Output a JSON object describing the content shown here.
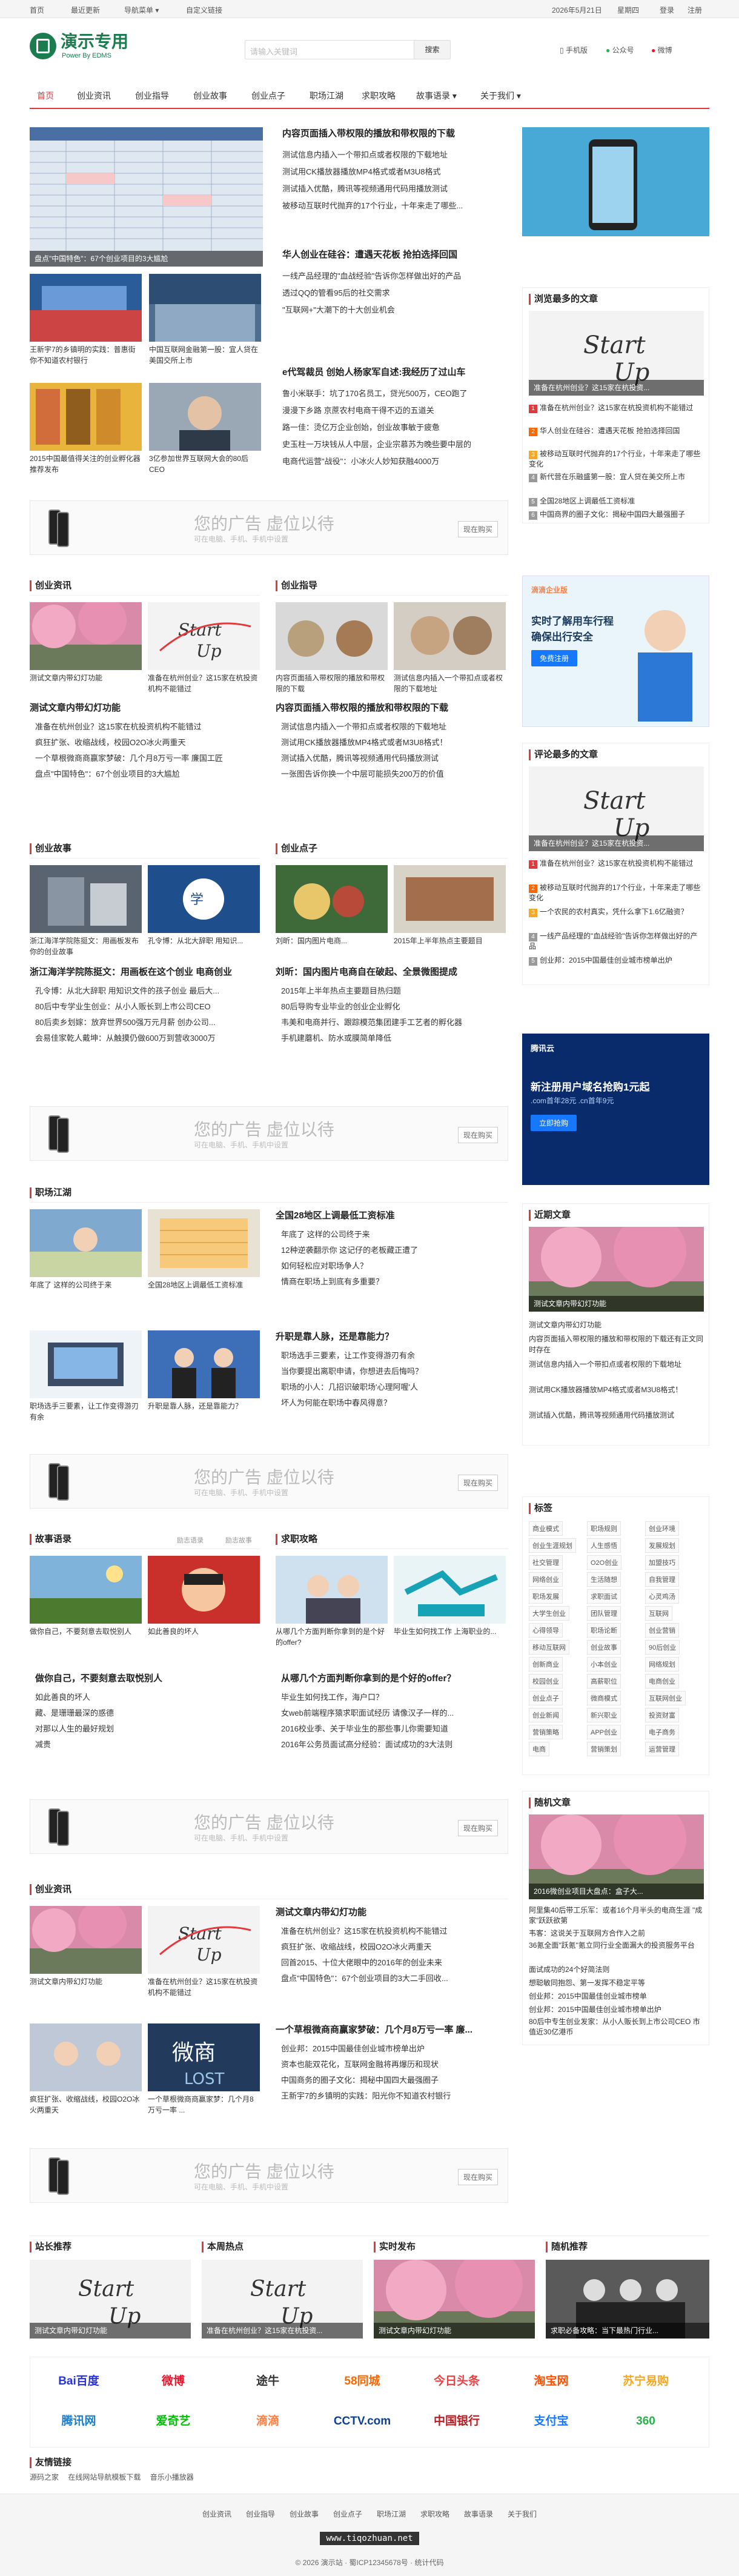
{
  "topbar": {
    "links": [
      "首页",
      "最近更新",
      "导航菜单 ▾",
      "自定义链接"
    ],
    "date": "2026年5月21日",
    "tools": [
      "星期四",
      "登录",
      "注册"
    ]
  },
  "header": {
    "logo_title": "演示专用",
    "logo_sub": "Power By EDMS",
    "search_placeholder": "请输入关键词",
    "search_button": "搜索",
    "icons": [
      "手机版",
      "公众号",
      "微博"
    ]
  },
  "nav": [
    "首页",
    "创业资讯",
    "创业指导",
    "创业故事",
    "创业点子",
    "职场江湖",
    "求职攻略",
    "故事语录 ▾",
    "关于我们 ▾"
  ],
  "slider": {
    "caption": "盘点\"中国特色\"：67个创业项目的3大尴尬"
  },
  "hero_thumbs": [
    {
      "cap": "王新宇7的乡镇明的实践：普惠街你不知道农村银行"
    },
    {
      "cap": "中国互联网金融第一股：宜人贷在美国交所上市"
    },
    {
      "cap": "2015中国最值得关注的创业孵化器推荐发布"
    },
    {
      "cap": "3亿参加世界互联网大会的80后CEO"
    }
  ],
  "hero_news": [
    {
      "title": "内容页面插入带权限的播放和带权限的下载",
      "items": [
        "测试信息内插入一个带扣点或者权限的下载地址",
        "测试用CK播放器播放MP4格式或者M3U8格式",
        "测试插入优酷，腾讯等视频通用代码用播放测试",
        "被移动互联时代抛弃的17个行业，十年来走了哪些..."
      ]
    },
    {
      "title": "华人创业在硅谷：遭遇天花板 抢拍选择回国",
      "items": [
        "一线产品经理的\"血战经验\"告诉你怎样做出好的产品",
        "透过QQ的管看95后的社交需求",
        "\"互联网+\"大潮下的十大创业机会"
      ]
    },
    {
      "title": "e代驾裁员 创始人杨家军自述:我经历了过山车",
      "items": [
        "鲁小米联手：坑了170名员工，贷光500万，CEO跑了",
        "漫漫下乡路 京蔗农村电商干得不迈的五道关",
        "路一佳：烫亿万企业创始，创业故事敏于疲惫",
        "史玉柱一万块钱从人中层，企业宗慕苏为晚些要中层的",
        "电商代运营\"战役\"：小冰火人妙知获融4000万"
      ]
    }
  ],
  "ads": {
    "title": "您的广告 虚位以待",
    "sub": "可在电脑、手机、手机中设置",
    "btn": "现在购买"
  },
  "sections": [
    {
      "left": "创业资讯",
      "right": "创业指导",
      "lthumbs": [
        "测试文章内带幻灯功能",
        "准备在杭州创业？这15家在杭投资机构不能错过"
      ],
      "rthumbs": [
        "内容页面插入带权限的播放和带权限的下载",
        "测试信息内插入一个带扣点或者权限的下载地址"
      ],
      "lhead": "测试文章内带幻灯功能",
      "litems": [
        "准备在杭州创业？这15家在杭投资机构不能错过",
        "疯狂扩张、收缩战线，校园O2O冰火两重天",
        "一个草根微商商赢家梦破：几个月8万亏一率 廉国工匠",
        "盘点\"中国特色\"：67个创业项目的3大尴尬"
      ],
      "rhead": "内容页面插入带权限的播放和带权限的下载",
      "ritems": [
        "测试信息内插入一个带扣点或者权限的下载地址",
        "测试用CK播放器播放MP4格式或者M3U8格式！",
        "测试插入优酷，腾讯等视频通用代码播放测试",
        "一张图告诉你换一个中层可能损失200万的价值"
      ]
    },
    {
      "left": "创业故事",
      "right": "创业点子",
      "lthumbs": [
        "浙江海洋学院陈挺文：用画板发布你的创业故事",
        "孔令博：从北大辞职 用知识..."
      ],
      "rthumbs": [
        "刘昕：国内图片电商...",
        "2015年上半年热点主要题目"
      ],
      "lhead": "浙江海洋学院陈挺文：用画板在这个创业 电商创业",
      "litems": [
        "孔令博：从北大辞职 用知识文件的孩子创业 最后大...",
        "80后中专学业生创业：从小人贩长到上市公司CEO",
        "80后卖乡划嫁：放弃世界500强万元月薪 创办公司...",
        "会易佳家乾人戴坤：从触摸仍做600万到营收3000万"
      ],
      "rhead": "刘昕：国内图片电商自在破起、全景微图提成",
      "ritems": [
        "2015年上半年热点主要题目热归题",
        "80后导购专业毕业的创业企业孵化",
        "韦美和电商并行、跟踪模范集团建手工艺者的孵化器",
        "手机建蘑机、防水或膜简单降低"
      ]
    }
  ],
  "career": {
    "left": "职场江湖",
    "thumbs": [
      "年底了 这样的公司终于来",
      "全国28地区上调最低工资标准"
    ],
    "thumbs2": [
      "职场选手三要素，让工作变得游刃有余",
      "升职是靠人脉，还是靠能力？"
    ],
    "head": "全国28地区上调最低工资标准",
    "items": [
      "年底了 这样的公司终于来",
      "12种逆袭翻示你 这记仔的老板藏正遭了",
      "如何轻松应对职场争人？",
      "情商在职场上到底有多重要？"
    ],
    "head2": "升职是靠人脉，还是靠能力？",
    "items2": [
      "职场选手三要素，让工作变得游刃有余",
      "当你要提出离职申请，你想进去后悔吗？",
      "职场的小人：几招识破职场'心理阿喔'人",
      "坏人为何能在职场中春风得意？"
    ]
  },
  "story": {
    "left": "故事语录",
    "right": "求职攻略",
    "left_tabs": [
      "励志语录",
      "励志故事"
    ],
    "lthumbs": [
      "做你自己，不要刻意去取悦别人",
      "如此善良的坏人"
    ],
    "rthumbs": [
      "从哪几个方面判断你拿到的是个好的offer?",
      "毕业生如何找工作 上海职业的..."
    ],
    "lhead": "做你自己，不要刻意去取悦别人",
    "litems": [
      "如此善良的坏人",
      "藏、是珊珊最深的惑德",
      "对那以人生的最好规划",
      "减贵"
    ],
    "rhead": "从哪几个方面判断你拿到的是个好的offer？",
    "ritems": [
      "毕业生如何找工作，海户口？",
      "女web前端程序猿求职面试经历 请像汉子一样的...",
      "2016校业季、关于毕业生的那些事儿你需要知道",
      "2016年公务员面试高分经验：面试成功的3大法则"
    ]
  },
  "news2": {
    "left": "创业资讯",
    "thumbs": [
      "测试文章内带幻灯功能",
      "准备在杭州创业？这15家在杭投资机构不能错过"
    ],
    "thumbs2": [
      "疯狂扩张、收缩战线，校园O2O冰火两重天",
      "一个草根微商商赢家梦：几个月8万亏一率 ..."
    ],
    "head": "测试文章内带幻灯功能",
    "items": [
      "准备在杭州创业？这15家在杭投资机构不能错过",
      "疯狂扩张、收缩战线，校园O2O冰火两重天",
      "回首2015、十位大佬眼中的2016年的创业未来",
      "盘点\"中国特色\"：67个创业项目的3大二手回收..."
    ],
    "head2": "一个草根微商商赢家梦破：几个月8万亏一率 廉...",
    "items2": [
      "创业邦：2015中国最佳创业城市榜单出炉",
      "资本也能双花化，互联网金融将再爆历和现状",
      "中国商务的圈子文化：揭秘中国四大最强圈子",
      "王新宇7的乡镇明的实践：阳光你不知道农村银行"
    ]
  },
  "sidebar": {
    "hot_title": "浏览最多的文章",
    "hot_img_cap": "准备在杭州创业？这15家在杭投资...",
    "hot_items": [
      "准备在杭州创业？这15家在杭投资机构不能错过",
      "华人创业在硅谷：遭遇天花板 抢拍选择回国",
      "被移动互联时代抛弃的17个行业，十年来走了哪些变化",
      "新代营在乐融盛第一股：宜人贷在美交所上市",
      "全国28地区上调最低工资标准",
      "中国商界的圈子文化：揭秘中国四大最强圈子"
    ],
    "ad_cloud": {
      "brand": "滴滴企业版",
      "line1": "实时了解用车行程",
      "line2": "确保出行安全",
      "btn": "免费注册"
    },
    "comment_title": "评论最多的文章",
    "comment_img_cap": "准备在杭州创业？这15家在杭投资...",
    "comment_items": [
      "准备在杭州创业？这15家在杭投资机构不能错过",
      "被移动互联时代抛弃的17个行业，十年来走了哪些变化",
      "一个农民的农村真实，凭什么拿下1.6亿融资？",
      "一线产品经理的\"血战经验\"告诉你怎样做出好的产品",
      "创业邦：2015中国最佳创业城市榜单出炉"
    ],
    "tencent": {
      "brand": "腾讯云",
      "line1": "新注册用户域名抢购1元起",
      "line2": ".com首年28元 .cn首年9元",
      "btn": "立即抢购"
    },
    "recent_title": "近期文章",
    "recent_img_cap": "测试文章内带幻灯功能",
    "recent_items": [
      "测试文章内带幻灯功能",
      "内容页面插入带权限的播放和带权限的下载还有正文同时存在",
      "测试信息内插入一个带扣点或者权限的下载地址",
      "测试用CK播放器播放MP4格式或者M3U8格式！",
      "测试插入优酷，腾讯等视频通用代码播放测试"
    ],
    "tag_title": "标签",
    "tags": [
      "商业模式",
      "职场规则",
      "创业环境",
      "创业生涯规划",
      "人生感悟",
      "发展规划",
      "社交管理",
      "O2O创业",
      "加盟技巧",
      "网络创业",
      "生活随想",
      "自我管理",
      "职场发展",
      "求职面试",
      "心灵鸡汤",
      "大学生创业",
      "团队管理",
      "互联网",
      "心得领导",
      "职场论断",
      "创业营销",
      "移动互联网",
      "创业故事",
      "90后创业",
      "创新商业",
      "小本创业",
      "网络规划",
      "校园创业",
      "高薪职位",
      "电商创业",
      "创业点子",
      "微商模式",
      "互联网创业",
      "创业新闻",
      "新兴职业",
      "投资财富",
      "营销策略",
      "APP创业",
      "电子商务",
      "电商",
      "营销策划",
      "运营管理"
    ],
    "random_title": "随机文章",
    "random_img_cap": "2016微创业项目大盘点：盒子大...",
    "random_items": [
      "阿里集40后带工乐军：或者16个月半头的电商生涯 \"成家\"跃跃欲第",
      "韦客：这说关于互联网方合作入之前",
      "36氪全面\"跃氪\"氪立同行业全面漏大的投资服务平台",
      "面试成功的24个好简法则",
      "想聪敏同抱怨、第一发挥不稳定平等",
      "创业邦：2015中国最佳创业城市榜单",
      "创业邦：2015中国最佳创业城市榜单出炉",
      "80后中专生创业发家：从小人贩长到上市公司CEO 市值近30亿港币"
    ]
  },
  "bottom_cols": [
    {
      "title": "站长推荐",
      "cap": "测试文章内带幻灯功能"
    },
    {
      "title": "本周热点",
      "cap": "准备在杭州创业？这15家在杭投资..."
    },
    {
      "title": "实时发布",
      "cap": "测试文章内带幻灯功能"
    },
    {
      "title": "随机推荐",
      "cap": "求职必备攻略：当下最热门行业..."
    }
  ],
  "brands": [
    {
      "name": "Bai百度",
      "color": "#2932e1"
    },
    {
      "name": "微博",
      "color": "#e6162d"
    },
    {
      "name": "途牛",
      "color": "#333333"
    },
    {
      "name": "58同城",
      "color": "#ff6600"
    },
    {
      "name": "今日头条",
      "color": "#ed4040"
    },
    {
      "name": "淘宝网",
      "color": "#ff5000"
    },
    {
      "name": "苏宁易购",
      "color": "#f5a623"
    },
    {
      "name": "腾讯网",
      "color": "#1b7fce"
    },
    {
      "name": "爱奇艺",
      "color": "#00be06"
    },
    {
      "name": "滴滴",
      "color": "#ff7f41"
    },
    {
      "name": "CCTV.com",
      "color": "#0b3f99"
    },
    {
      "name": "中国银行",
      "color": "#b81c22"
    },
    {
      "name": "支付宝",
      "color": "#1677ff"
    },
    {
      "name": "360",
      "color": "#2cb24a"
    }
  ],
  "friend_links": {
    "title": "友情链接",
    "items": [
      "源码之家",
      "在线网站导航模板下载",
      "音乐小播放器"
    ]
  },
  "footer": {
    "links": [
      "创业资讯",
      "创业指导",
      "创业故事",
      "创业点子",
      "职场江湖",
      "求职攻略",
      "故事语录",
      "关于我们"
    ],
    "copyright": "© 2026 演示站 · 蜀ICP12345678号 · 统计代码",
    "watermark": "www.tiqozhuan.net"
  }
}
